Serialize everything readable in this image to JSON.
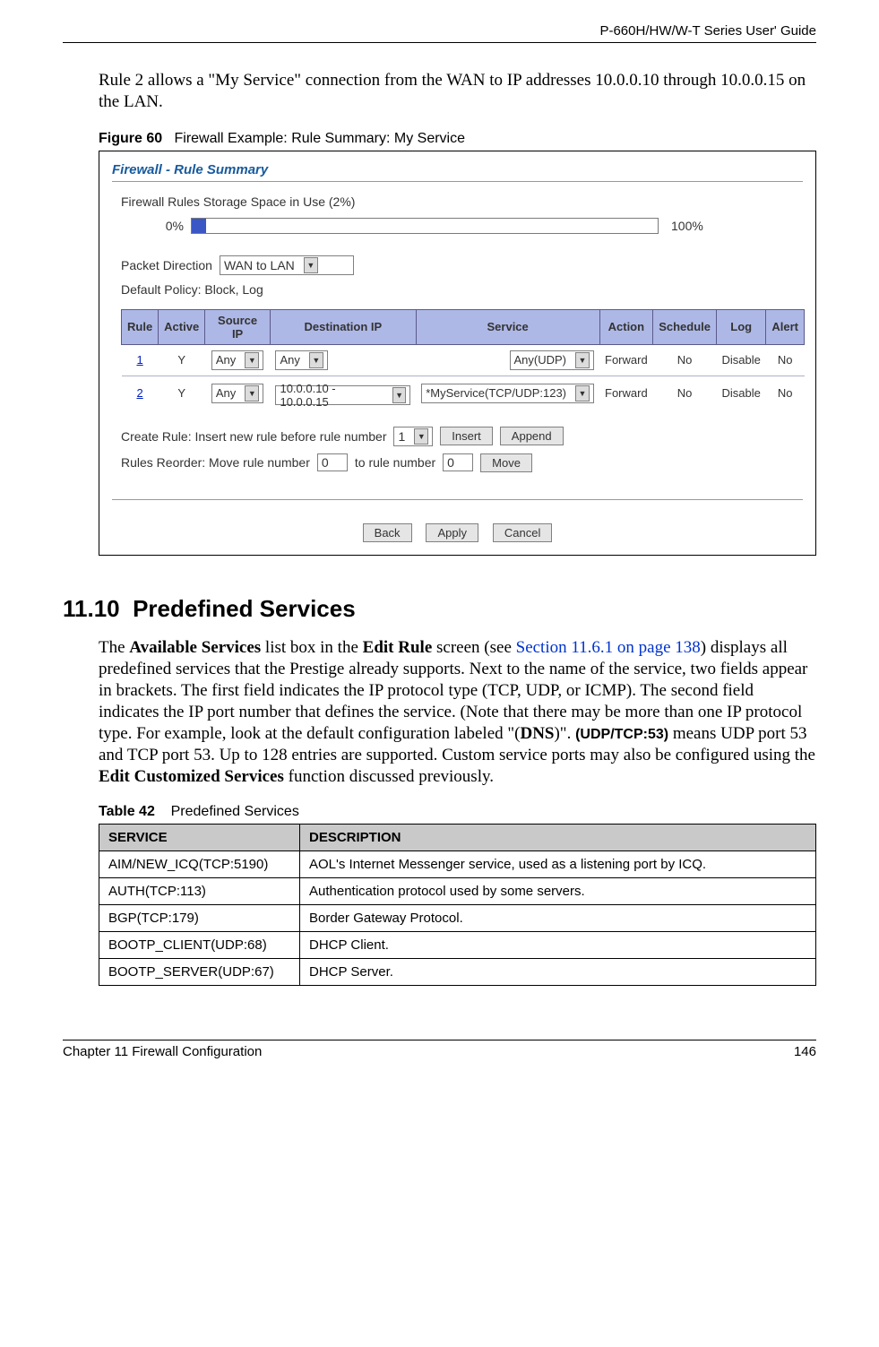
{
  "header": {
    "running": "P-660H/HW/W-T Series User' Guide"
  },
  "intro_para": "Rule 2 allows a \"My Service\" connection from the WAN to IP addresses 10.0.0.10 through 10.0.0.15 on the LAN.",
  "figure": {
    "label": "Figure 60",
    "title": "Firewall Example: Rule Summary: My Service",
    "panel": {
      "title": "Firewall - Rule Summary",
      "storage_label": "Firewall Rules Storage Space in Use  (2%)",
      "pct_left": "0%",
      "pct_right": "100%",
      "packet_direction_label": "Packet Direction",
      "packet_direction_value": "WAN to LAN",
      "default_policy": "Default Policy: Block, Log",
      "headers": {
        "rule": "Rule",
        "active": "Active",
        "source": "Source IP",
        "dest": "Destination IP",
        "service": "Service",
        "action": "Action",
        "schedule": "Schedule",
        "log": "Log",
        "alert": "Alert"
      },
      "rows": [
        {
          "rule": "1",
          "active": "Y",
          "source": "Any",
          "dest": "Any",
          "service": "Any(UDP)",
          "action": "Forward",
          "schedule": "No",
          "log": "Disable",
          "alert": "No"
        },
        {
          "rule": "2",
          "active": "Y",
          "source": "Any",
          "dest": "10.0.0.10 - 10.0.0.15",
          "service": "*MyService(TCP/UDP:123)",
          "action": "Forward",
          "schedule": "No",
          "log": "Disable",
          "alert": "No"
        }
      ],
      "create_rule_label": "Create Rule: Insert new rule before rule number",
      "create_rule_value": "1",
      "insert_btn": "Insert",
      "append_btn": "Append",
      "reorder_label_left": "Rules Reorder: Move rule number",
      "reorder_from": "0",
      "reorder_label_mid": "to rule number",
      "reorder_to": "0",
      "move_btn": "Move",
      "back_btn": "Back",
      "apply_btn": "Apply",
      "cancel_btn": "Cancel"
    }
  },
  "section": {
    "number": "11.10",
    "title": "Predefined Services"
  },
  "predef_para": {
    "t1": "The ",
    "b1": "Available Services",
    "t2": " list box in the ",
    "b2": "Edit Rule",
    "t3": " screen (see ",
    "link": "Section 11.6.1 on page 138",
    "t4": ") displays all predefined services that the Prestige already supports. Next to the name of the service, two fields appear in brackets. The first field indicates the IP protocol type (TCP, UDP, or ICMP). The second field indicates the IP port number that defines the service. (Note that there may be more than one IP protocol type. For example, look at the default configuration labeled \"(",
    "b3": "DNS",
    "t5": ")\". ",
    "small_bold": "(UDP/TCP:53)",
    "t6": " means UDP port 53 and TCP port 53. Up to 128 entries are supported. Custom service ports may also be configured using the ",
    "b4": "Edit Customized Services",
    "t7": " function discussed previously."
  },
  "table42": {
    "label": "Table 42",
    "title": "Predefined Services",
    "headers": {
      "service": "SERVICE",
      "description": "DESCRIPTION"
    },
    "rows": [
      {
        "service": "AIM/NEW_ICQ(TCP:5190)",
        "description": "AOL's Internet Messenger service, used as a listening port by ICQ."
      },
      {
        "service": "AUTH(TCP:113)",
        "description": "Authentication protocol used by some servers."
      },
      {
        "service": "BGP(TCP:179)",
        "description": "Border Gateway Protocol."
      },
      {
        "service": "BOOTP_CLIENT(UDP:68)",
        "description": "DHCP Client."
      },
      {
        "service": "BOOTP_SERVER(UDP:67)",
        "description": "DHCP Server."
      }
    ]
  },
  "footer": {
    "left": "Chapter 11 Firewall Configuration",
    "right": "146"
  }
}
